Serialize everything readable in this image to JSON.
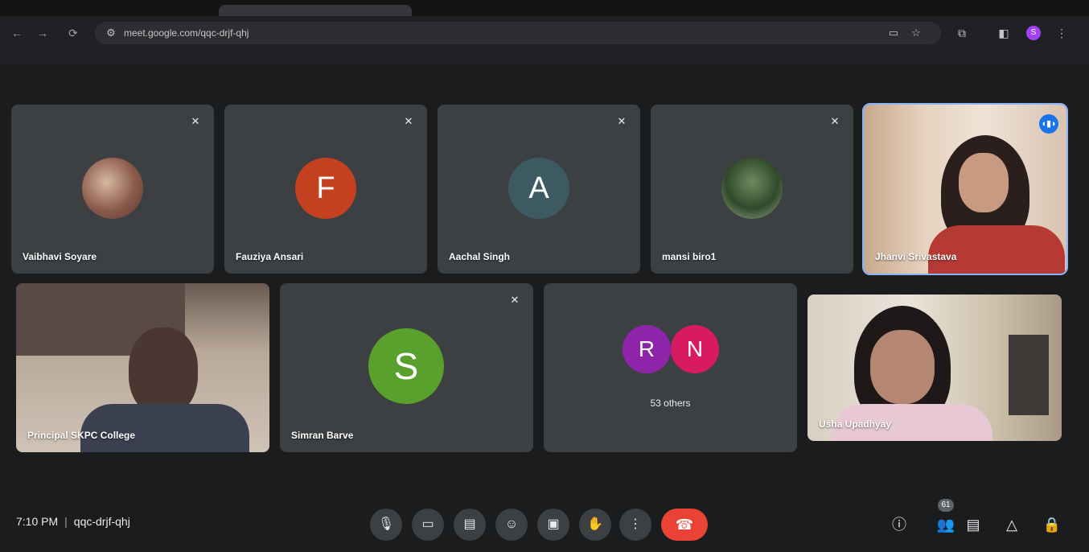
{
  "browser": {
    "url": "meet.google.com/qqc-drjf-qhj",
    "nav": {
      "back": "←",
      "forward": "→",
      "reload": "⟳"
    },
    "profile_initial": "S"
  },
  "tiles_row1": [
    {
      "name": "Vaibhavi Soyare",
      "type": "photo"
    },
    {
      "name": "Fauziya Ansari",
      "type": "letter",
      "letter": "F",
      "color": "#c5401e"
    },
    {
      "name": "Aachal Singh",
      "type": "letter",
      "letter": "A",
      "color": "#3d5a62"
    },
    {
      "name": "mansi biro1",
      "type": "photo"
    },
    {
      "name": "Jhanvi Srivastava",
      "type": "video"
    }
  ],
  "tiles_row2": [
    {
      "name": "Principal SKPC College",
      "type": "video"
    },
    {
      "name": "Simran Barve",
      "type": "letter",
      "letter": "S",
      "color": "#5aa02c"
    },
    {
      "name": "53 others",
      "type": "others",
      "letters": [
        "R",
        "N"
      ],
      "colors": [
        "#8e24aa",
        "#d81b60"
      ]
    },
    {
      "name": "Usha Upadhyay",
      "type": "video"
    }
  ],
  "footer": {
    "time": "7:10 PM",
    "separator": "|",
    "meeting_code": "qqc-drjf-qhj",
    "people_count": "61"
  },
  "colors": {
    "background": "#1b1c1e",
    "tile": "#3c4043",
    "end_call": "#ea4335",
    "speaking": "#1a73e8"
  }
}
